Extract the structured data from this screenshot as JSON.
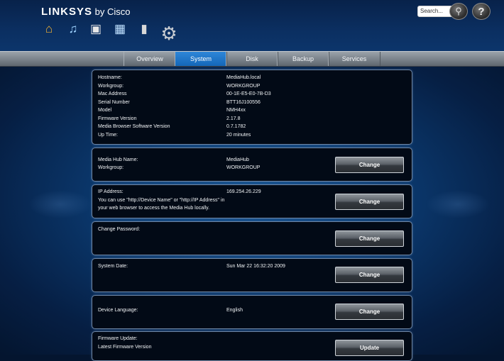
{
  "header": {
    "brand": "LINKSYS",
    "brand_suffix": " by Cisco",
    "search_placeholder": "Search...",
    "help_label": "?"
  },
  "tabs": [
    {
      "label": "Overview",
      "active": false
    },
    {
      "label": "System",
      "active": true
    },
    {
      "label": "Disk",
      "active": false
    },
    {
      "label": "Backup",
      "active": false
    },
    {
      "label": "Services",
      "active": false
    }
  ],
  "info": {
    "rows": [
      {
        "label": "Hostname:",
        "value": "MediaHub.local"
      },
      {
        "label": "Workgroup:",
        "value": "WORKGROUP"
      },
      {
        "label": "Mac Address",
        "value": "00-1E-E5-E0-7B-D3"
      },
      {
        "label": "Serial Number",
        "value": "BTT16J100556"
      },
      {
        "label": "Model",
        "value": "NMH4xx"
      },
      {
        "label": "Firmware Version",
        "value": "2.17.8"
      },
      {
        "label": "Media Browser Software Version",
        "value": "0.7.1782"
      },
      {
        "label": "Up Time:",
        "value": "20 minutes"
      }
    ]
  },
  "name_panel": {
    "name_label": "Media Hub Name:",
    "name_value": "MediaHub",
    "workgroup_label": "Workgroup:",
    "workgroup_value": "WORKGROUP",
    "button": "Change"
  },
  "ip_panel": {
    "label": "IP Address:",
    "value": "169.254.26.229",
    "hint_line1": "You can use \"http://Device Name\" or \"http://IP Address\" in",
    "hint_line2": "your web browser to access the Media Hub locally.",
    "button": "Change"
  },
  "password_panel": {
    "label": "Change Password:",
    "button": "Change"
  },
  "date_panel": {
    "label": "System Date:",
    "value": "Sun Mar 22 16:32:20 2009",
    "button": "Change"
  },
  "language_panel": {
    "label": "Device Language:",
    "value": "English",
    "button": "Change"
  },
  "firmware_panel": {
    "label": "Firmware Update:",
    "latest_label": "Latest Firmware Version",
    "button": "Update"
  },
  "colors": {
    "accent_tab": "#1f78c9",
    "panel_bg": "#020a16",
    "panel_border": "#6f86a4"
  }
}
